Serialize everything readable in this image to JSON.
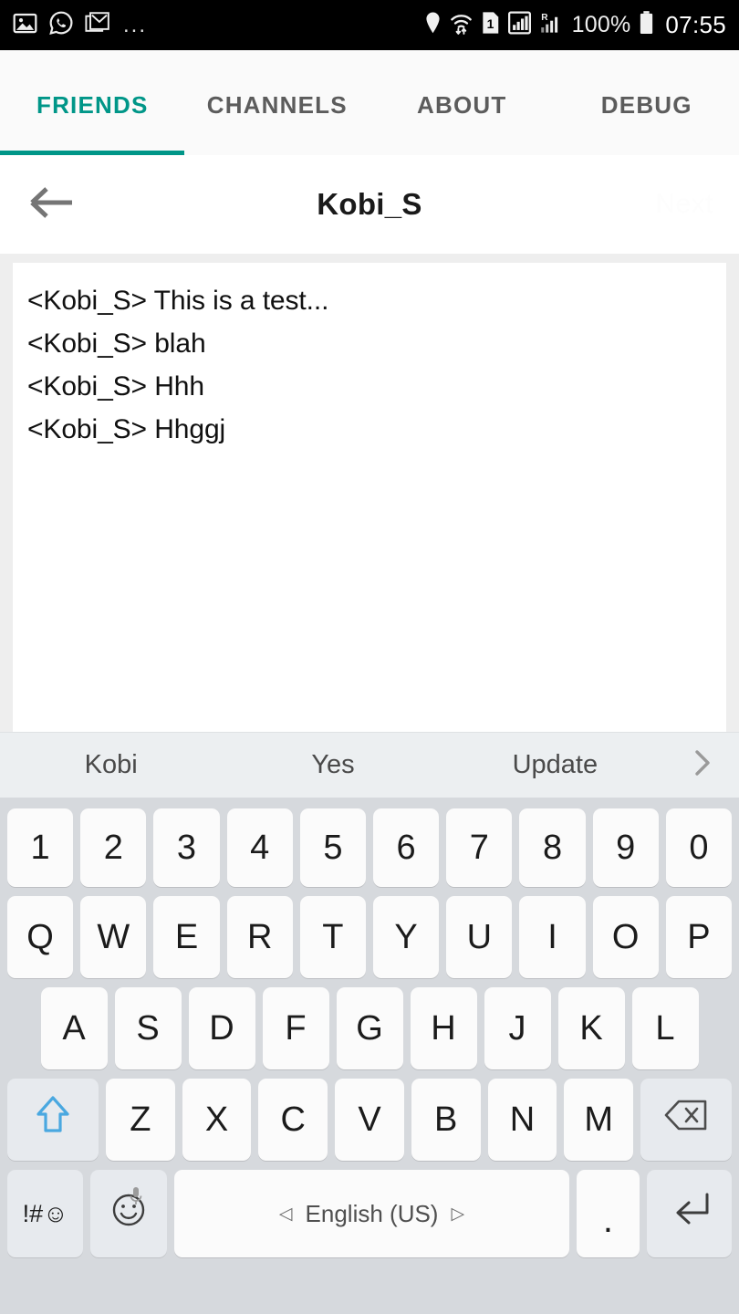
{
  "statusbar": {
    "left_icons": [
      "gallery-icon",
      "whatsapp-icon",
      "gmail-icon"
    ],
    "overflow": "...",
    "right_icons": [
      "location-pin-icon",
      "wifi-icon",
      "sim-1-icon",
      "signal-boxed-icon",
      "roaming-signal-icon"
    ],
    "battery_percent": "100%",
    "battery_icon": "battery-full-icon",
    "time": "07:55"
  },
  "tabs": [
    {
      "label": "FRIENDS",
      "active": true
    },
    {
      "label": "CHANNELS",
      "active": false
    },
    {
      "label": "ABOUT",
      "active": false
    },
    {
      "label": "DEBUG",
      "active": false
    }
  ],
  "titlebar": {
    "back_icon": "arrow-left-icon",
    "title": "Kobi_S",
    "next_label": "Next"
  },
  "chat": {
    "lines": [
      "<Kobi_S> This is a test...",
      "<Kobi_S> blah",
      "<Kobi_S> Hhh",
      "<Kobi_S> Hhggj"
    ]
  },
  "suggestions": {
    "items": [
      "Kobi",
      "Yes",
      "Update"
    ],
    "more_icon": "chevron-right-icon"
  },
  "keyboard": {
    "row1": [
      "1",
      "2",
      "3",
      "4",
      "5",
      "6",
      "7",
      "8",
      "9",
      "0"
    ],
    "row2": [
      "Q",
      "W",
      "E",
      "R",
      "T",
      "Y",
      "U",
      "I",
      "O",
      "P"
    ],
    "row3": [
      "A",
      "S",
      "D",
      "F",
      "G",
      "H",
      "J",
      "K",
      "L"
    ],
    "row4_letters": [
      "Z",
      "X",
      "C",
      "V",
      "B",
      "N",
      "M"
    ],
    "shift_icon": "shift-arrow-up-icon",
    "delete_icon": "backspace-icon",
    "symbols_label": "!#☺",
    "emoji_icon": "emoji-smiley-icon",
    "mic_icon": "microphone-icon",
    "space_label": "English (US)",
    "space_prev_icon": "◁",
    "space_next_icon": "▷",
    "period_label": ".",
    "enter_icon": "enter-return-icon"
  },
  "colors": {
    "accent_teal": "#009688",
    "status_bar_bg": "#000000",
    "tab_bar_bg": "#fafafa",
    "keyboard_bg": "#d6d9dd",
    "key_bg": "#fbfbfb",
    "fn_key_bg": "#e7eaee",
    "shift_blue": "#4aa8e0",
    "suggest_bg": "#eceff1"
  }
}
